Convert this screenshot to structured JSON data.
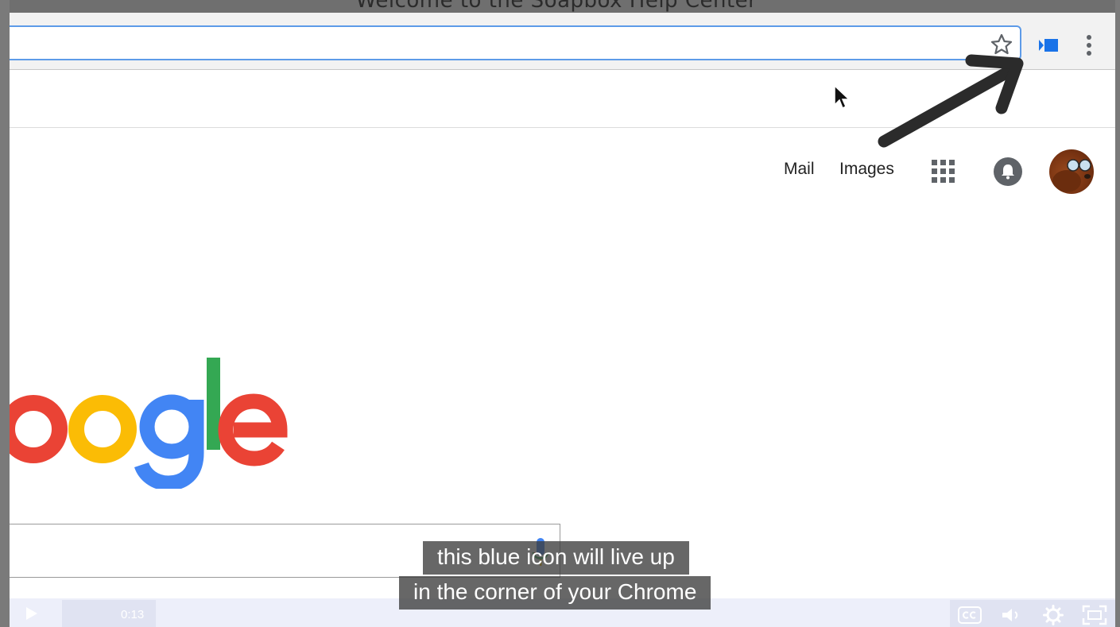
{
  "page_header": {
    "title": "Welcome to the Soapbox Help Center"
  },
  "browser": {
    "omnibox_value": "",
    "icons": [
      "star-icon",
      "soapbox-extension-icon",
      "chrome-menu-icon"
    ],
    "accent_color": "#1a73e8"
  },
  "google": {
    "header_links": {
      "mail": "Mail",
      "images": "Images"
    },
    "icons": [
      "apps-grid-icon",
      "notifications-bell-icon"
    ],
    "logo_text": "oogle",
    "logo_colors": [
      "#ea4335",
      "#fbbc05",
      "#4285f4",
      "#34a853",
      "#ea4335"
    ],
    "search_value": ""
  },
  "player": {
    "time": "0:13",
    "captions": [
      "this blue icon will live up",
      "in the corner of your Chrome"
    ],
    "icons": [
      "play-icon",
      "closed-captions-icon",
      "volume-icon",
      "settings-gear-icon",
      "fullscreen-icon"
    ]
  }
}
